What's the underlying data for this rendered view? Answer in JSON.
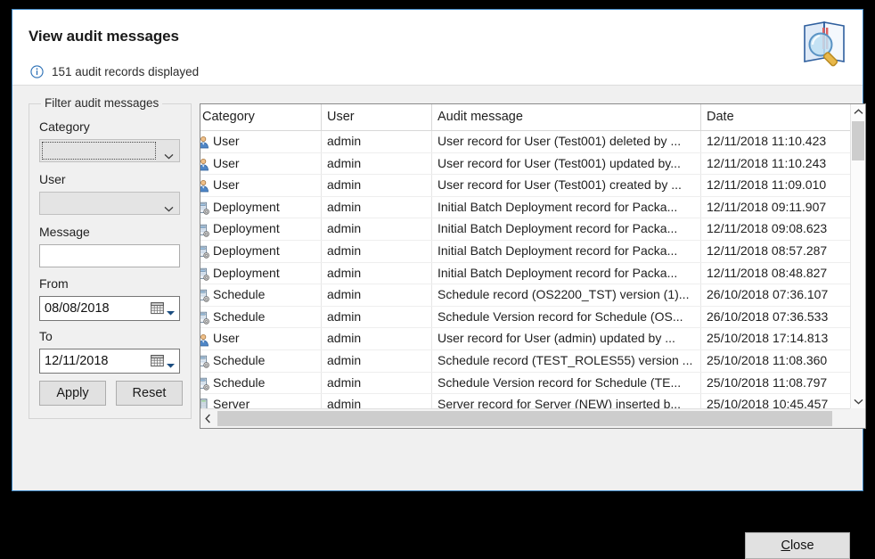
{
  "dialog": {
    "title": "View audit messages",
    "status_text": "151 audit records displayed",
    "info_icon": "info-circle-icon",
    "header_icon": "book-magnifier-icon",
    "accent_color": "#3f88c5"
  },
  "filter": {
    "legend": "Filter audit messages",
    "category": {
      "label": "Category",
      "value": "",
      "placeholder": ""
    },
    "user": {
      "label": "User",
      "value": "",
      "placeholder": ""
    },
    "message": {
      "label": "Message",
      "value": "",
      "placeholder": ""
    },
    "from": {
      "label": "From",
      "value": "08/08/2018"
    },
    "to": {
      "label": "To",
      "value": "12/11/2018"
    },
    "apply_label": "Apply",
    "reset_label": "Reset"
  },
  "table": {
    "columns": [
      {
        "key": "category",
        "label": "Category"
      },
      {
        "key": "user",
        "label": "User"
      },
      {
        "key": "message",
        "label": "Audit message"
      },
      {
        "key": "date",
        "label": "Date"
      }
    ],
    "rows": [
      {
        "icon": "user-icon",
        "category": "User",
        "user": "admin",
        "message": "User record for User (Test001) deleted by ...",
        "date": "12/11/2018 11:10.423"
      },
      {
        "icon": "user-icon",
        "category": "User",
        "user": "admin",
        "message": "User record for User (Test001) updated by...",
        "date": "12/11/2018 11:10.243"
      },
      {
        "icon": "user-icon",
        "category": "User",
        "user": "admin",
        "message": "User record for User (Test001) created by ...",
        "date": "12/11/2018 11:09.010"
      },
      {
        "icon": "deployment-icon",
        "category": "Deployment",
        "user": "admin",
        "message": "Initial Batch Deployment record for Packa...",
        "date": "12/11/2018 09:11.907"
      },
      {
        "icon": "deployment-icon",
        "category": "Deployment",
        "user": "admin",
        "message": "Initial Batch Deployment record for Packa...",
        "date": "12/11/2018 09:08.623"
      },
      {
        "icon": "deployment-icon",
        "category": "Deployment",
        "user": "admin",
        "message": "Initial Batch Deployment record for Packa...",
        "date": "12/11/2018 08:57.287"
      },
      {
        "icon": "deployment-icon",
        "category": "Deployment",
        "user": "admin",
        "message": "Initial Batch Deployment record for Packa...",
        "date": "12/11/2018 08:48.827"
      },
      {
        "icon": "schedule-icon",
        "category": "Schedule",
        "user": "admin",
        "message": "Schedule record (OS2200_TST) version (1)...",
        "date": "26/10/2018 07:36.107"
      },
      {
        "icon": "schedule-icon",
        "category": "Schedule",
        "user": "admin",
        "message": "Schedule Version record for Schedule (OS...",
        "date": "26/10/2018 07:36.533"
      },
      {
        "icon": "user-icon",
        "category": "User",
        "user": "admin",
        "message": "User record for User (admin) updated by ...",
        "date": "25/10/2018 17:14.813"
      },
      {
        "icon": "schedule-icon",
        "category": "Schedule",
        "user": "admin",
        "message": "Schedule record (TEST_ROLES55) version ...",
        "date": "25/10/2018 11:08.360"
      },
      {
        "icon": "schedule-icon",
        "category": "Schedule",
        "user": "admin",
        "message": "Schedule Version record for Schedule (TE...",
        "date": "25/10/2018 11:08.797"
      },
      {
        "icon": "server-icon",
        "category": "Server",
        "user": "admin",
        "message": "Server record for Server (NEW) inserted b...",
        "date": "25/10/2018 10:45.457"
      }
    ],
    "vscroll_up_icon": "chevron-up-icon",
    "vscroll_down_icon": "chevron-down-icon",
    "hscroll_left_icon": "chevron-left-icon",
    "hscroll_right_icon": "chevron-right-icon"
  },
  "footer": {
    "close_mnemonic": "C",
    "close_rest": "lose"
  }
}
